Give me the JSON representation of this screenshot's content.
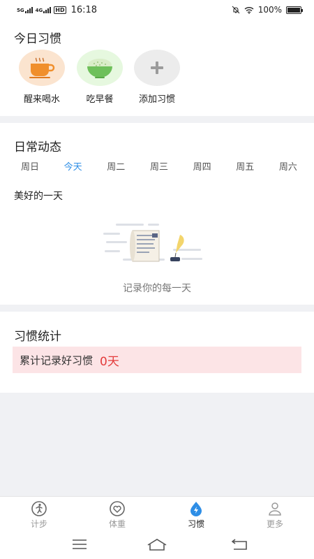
{
  "status": {
    "net1": "5G",
    "net2": "4G",
    "hd": "HD",
    "time": "16:18",
    "battery": "100%",
    "battery_level": 1.0
  },
  "habits": {
    "title": "今日习惯",
    "items": [
      {
        "label": "醒来喝水",
        "icon": "coffee-cup-icon",
        "color": "#fbe4cf"
      },
      {
        "label": "吃早餐",
        "icon": "rice-bowl-icon",
        "color": "#e6f8df"
      },
      {
        "label": "添加习惯",
        "icon": "plus-icon",
        "color": "#ececec"
      }
    ]
  },
  "daily": {
    "title": "日常动态",
    "days": [
      "周日",
      "今天",
      "周二",
      "周三",
      "周四",
      "周五",
      "周六"
    ],
    "active_day": "今天",
    "subtitle": "美好的一天",
    "empty_text": "记录你的每一天"
  },
  "stats": {
    "title": "习惯统计",
    "label": "累计记录好习惯",
    "value": "0天"
  },
  "tabs": [
    {
      "label": "计步",
      "icon": "walking-icon"
    },
    {
      "label": "体重",
      "icon": "heart-icon"
    },
    {
      "label": "习惯",
      "icon": "drop-bolt-icon",
      "active": true
    },
    {
      "label": "更多",
      "icon": "user-icon"
    }
  ],
  "colors": {
    "accent": "#2e8ee6",
    "highlight_bg": "#fce4e6",
    "highlight_text": "#e33b3b"
  }
}
